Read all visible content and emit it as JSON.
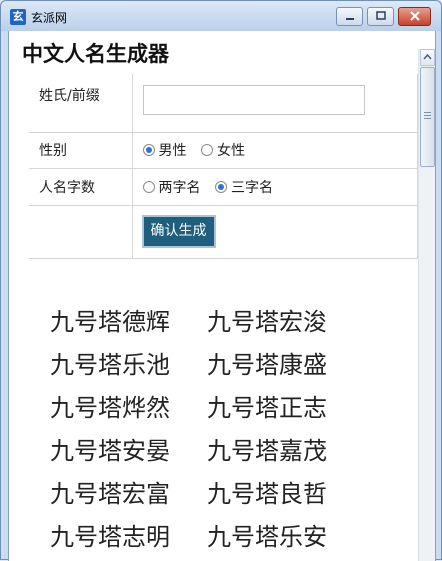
{
  "window": {
    "title": "玄派网",
    "app_icon_glyph": "玄"
  },
  "page": {
    "title": "中文人名生成器"
  },
  "form": {
    "surname_label": "姓氏/前缀",
    "surname_value": "",
    "gender_label": "性别",
    "gender_options": [
      "男性",
      "女性"
    ],
    "gender_selected": "男性",
    "length_label": "人名字数",
    "length_options": [
      "两字名",
      "三字名"
    ],
    "length_selected": "三字名",
    "submit_label": "确认生成"
  },
  "results": [
    [
      "九号塔德辉",
      "九号塔宏浚"
    ],
    [
      "九号塔乐池",
      "九号塔康盛"
    ],
    [
      "九号塔烨然",
      "九号塔正志"
    ],
    [
      "九号塔安晏",
      "九号塔嘉茂"
    ],
    [
      "九号塔宏富",
      "九号塔良哲"
    ],
    [
      "九号塔志明",
      "九号塔乐安"
    ]
  ],
  "colors": {
    "submit_bg": "#1d5f7d",
    "radio_checked": "#2f6fd6"
  }
}
